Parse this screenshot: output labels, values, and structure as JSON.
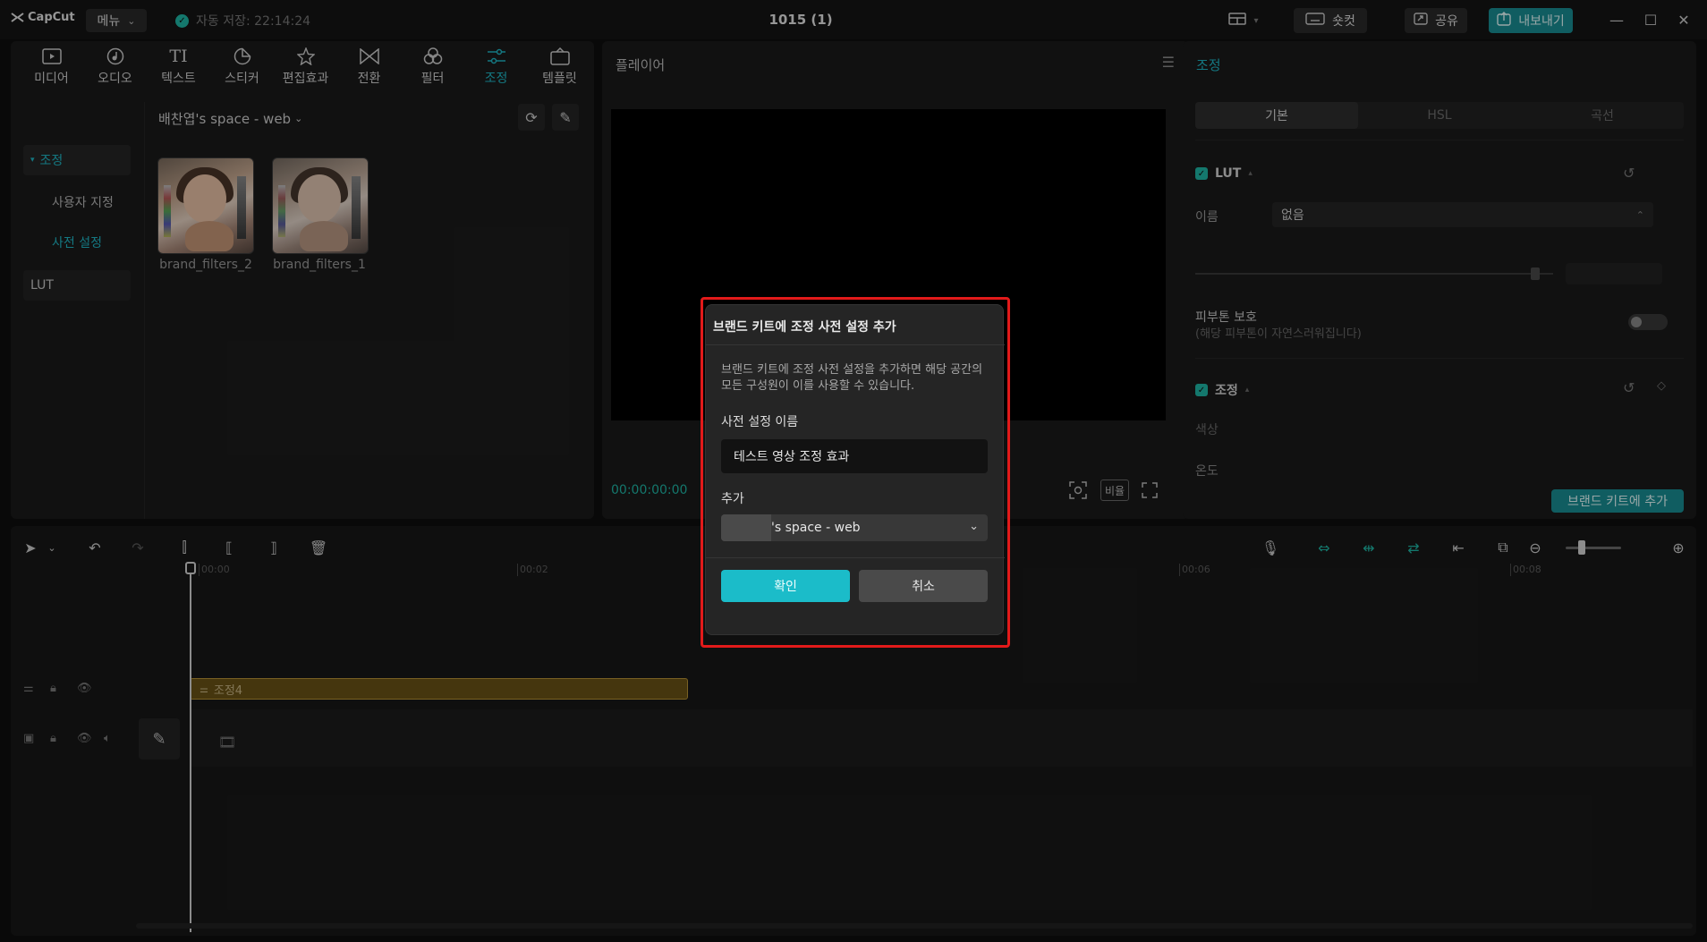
{
  "titlebar": {
    "app_name": "CapCut",
    "menu_label": "메뉴",
    "autosave_text": "자동 저장: 22:14:24",
    "document_title": "1015 (1)",
    "shortcut_label": "숏컷",
    "share_label": "공유",
    "export_label": "내보내기"
  },
  "tool_tabs": [
    {
      "label": "미디어",
      "icon": "media-icon"
    },
    {
      "label": "오디오",
      "icon": "audio-icon"
    },
    {
      "label": "텍스트",
      "icon": "text-icon"
    },
    {
      "label": "스티커",
      "icon": "sticker-icon"
    },
    {
      "label": "편집효과",
      "icon": "effects-icon"
    },
    {
      "label": "전환",
      "icon": "transition-icon"
    },
    {
      "label": "필터",
      "icon": "filter-icon"
    },
    {
      "label": "조정",
      "icon": "adjust-icon",
      "active": true
    },
    {
      "label": "템플릿",
      "icon": "template-icon"
    }
  ],
  "side_nav": {
    "header": "조정",
    "items": [
      "사용자 지정",
      "사전 설정"
    ],
    "lut": "LUT"
  },
  "media": {
    "space_selector": "배찬엽's space - web",
    "thumbnails": [
      "brand_filters_2",
      "brand_filters_1"
    ]
  },
  "player": {
    "title": "플레이어",
    "timecode": "00:00:00:00",
    "ratio_label": "비율"
  },
  "props": {
    "title": "조정",
    "segments": [
      "기본",
      "HSL",
      "곡선"
    ],
    "lut_header": "LUT",
    "name_label": "이름",
    "name_value": "없음",
    "skin_protect_label": "피부톤 보호",
    "skin_protect_desc": "(해당 피부톤이 자연스러워집니다)",
    "adjust_header": "조정",
    "color_label": "색상",
    "temp_label": "온도",
    "brand_add_button": "브랜드 키트에 추가"
  },
  "timeline": {
    "ruler": [
      "00:00",
      "00:02",
      "00:06",
      "00:08"
    ],
    "adjust_clip_label": "조정4"
  },
  "modal": {
    "title": "브랜드 키트에 조정 사전 설정 추가",
    "description": "브랜드 키트에 조정 사전 설정을 추가하면 해당 공간의 모든 구성원이 이를 사용할 수 있습니다.",
    "preset_name_label": "사전 설정 이름",
    "preset_name_value": "테스트 영상 조정 효과",
    "add_label": "추가",
    "space_value": "'s space - web",
    "confirm_label": "확인",
    "cancel_label": "취소"
  },
  "colors": {
    "accent": "#1fb8c8",
    "highlight_border": "#e21a1a",
    "clip": "#6b5416"
  }
}
